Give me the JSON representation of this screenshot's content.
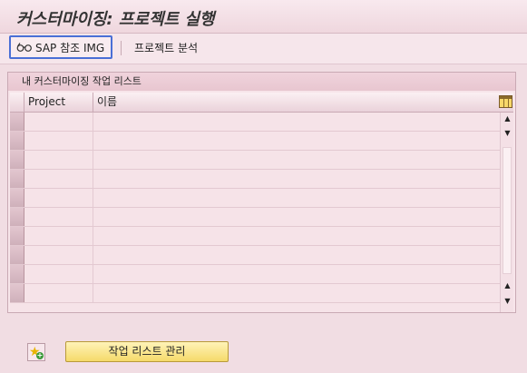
{
  "window": {
    "title": "커스터마이징: 프로젝트 실행"
  },
  "toolbar": {
    "sap_img_label": "SAP 참조 IMG",
    "project_analysis_label": "프로젝트 분석"
  },
  "worklist": {
    "title": "내 커스터마이징 작업 리스트",
    "columns": [
      "Project",
      "이름"
    ],
    "rows": [
      {
        "project": "",
        "name": ""
      },
      {
        "project": "",
        "name": ""
      },
      {
        "project": "",
        "name": ""
      },
      {
        "project": "",
        "name": ""
      },
      {
        "project": "",
        "name": ""
      },
      {
        "project": "",
        "name": ""
      },
      {
        "project": "",
        "name": ""
      },
      {
        "project": "",
        "name": ""
      },
      {
        "project": "",
        "name": ""
      },
      {
        "project": "",
        "name": ""
      }
    ]
  },
  "footer": {
    "manage_worklist_label": "작업 리스트 관리"
  },
  "icons": {
    "sap_img": "glasses-icon",
    "layout": "table-settings-icon",
    "favorite_add": "star-add-icon",
    "scroll_up": "triangle-up-icon",
    "scroll_down": "triangle-down-icon"
  },
  "colors": {
    "accent_selection": "#4a6fd6",
    "background": "#f1dde3",
    "button_yellow": "#f5da6a"
  }
}
